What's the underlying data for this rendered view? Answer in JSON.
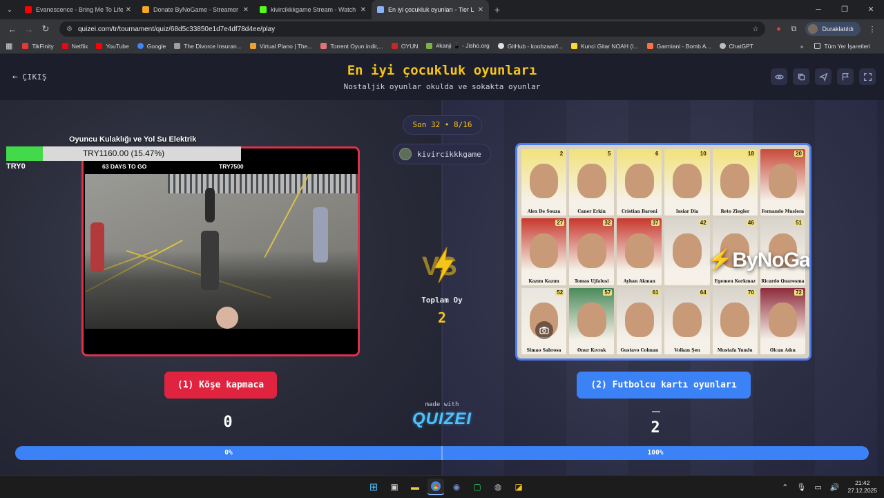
{
  "browser": {
    "tabs": [
      {
        "title": "Evanescence - Bring Me To Life",
        "icon_color": "#ff0000",
        "active": false
      },
      {
        "title": "Donate ByNoGame - Streamer",
        "icon_color": "#f5a623",
        "active": false
      },
      {
        "title": "kivircikkkgame Stream - Watch",
        "icon_color": "#53fc18",
        "active": false
      },
      {
        "title": "En iyi çocukluk oyunları - Tier L",
        "icon_color": "#8ab4f8",
        "active": true
      }
    ],
    "url": "quizei.com/tr/tournament/quiz/68d5c33850e1d7e4df78d4ee/play",
    "profile_label": "Duraklatıldı",
    "bookmarks": [
      {
        "label": "TikFinity",
        "color": "#e53935"
      },
      {
        "label": "Netflix",
        "color": "#e50914"
      },
      {
        "label": "YouTube",
        "color": "#ff0000"
      },
      {
        "label": "Google",
        "color": "#4285f4"
      },
      {
        "label": "The Divorce Insuran...",
        "color": "#9e9e9e"
      },
      {
        "label": "Virtual Piano | The...",
        "color": "#f0a030"
      },
      {
        "label": "Torrent Oyun indir,...",
        "color": "#e57373"
      },
      {
        "label": "OYUN",
        "color": "#c62828"
      },
      {
        "label": "#kanji 📱 - Jisho.org",
        "color": "#7cb342"
      },
      {
        "label": "GitHub - koobzaar/l...",
        "color": "#e0e0e0"
      },
      {
        "label": "Kunci Gitar NOAH (I...",
        "color": "#212121"
      },
      {
        "label": "Garmiani - Bomb A...",
        "color": "#ff7043"
      },
      {
        "label": "ChatGPT",
        "color": "#bdbdbd"
      }
    ],
    "bookmarks_folder": "Tüm Yer İşaretleri"
  },
  "header": {
    "exit_label": "ÇIKIŞ",
    "title": "En iyi çocukluk oyunları",
    "subtitle": "Nostaljik oyunlar okulda ve sokakta oyunlar"
  },
  "round": {
    "label": "Son 32 • 8/16",
    "streamer": "kivircikkkgame"
  },
  "donation_overlay": {
    "title": "Oyuncu Kulaklığı ve Yol Su Elektrik",
    "progress_text": "TRY1160.00 (15.47%)",
    "progress_fraction": 0.1547,
    "min": "TRY0",
    "goal_text": "63 DAYS TO GO",
    "max": "TRY7500"
  },
  "cards": {
    "left_watermark": "",
    "right_watermark": "ByNoGame",
    "player_cards": [
      {
        "name": "Alex De Souza",
        "num": "2"
      },
      {
        "name": "Caner Erkin",
        "num": "5"
      },
      {
        "name": "Cristian Baroni",
        "num": "6"
      },
      {
        "name": "Issiar Dia",
        "num": "10"
      },
      {
        "name": "Reto Ziegler",
        "num": "18"
      },
      {
        "name": "Fernando Muslera",
        "num": "20"
      },
      {
        "name": "Kazım Kazım",
        "num": "27"
      },
      {
        "name": "Tomas Ujfalusi",
        "num": "32"
      },
      {
        "name": "Ayhan Akman",
        "num": "37"
      },
      {
        "name": "",
        "num": "42"
      },
      {
        "name": "Egemen Korkmaz",
        "num": "46"
      },
      {
        "name": "Ricardo Quaresma",
        "num": "51"
      },
      {
        "name": "Simao Sabrosa",
        "num": "52"
      },
      {
        "name": "Onur Kıvrak",
        "num": "57"
      },
      {
        "name": "Gustavo Colman",
        "num": "61"
      },
      {
        "name": "Volkan Şen",
        "num": "64"
      },
      {
        "name": "Mustafa Yumlu",
        "num": "70"
      },
      {
        "name": "Olcan Adın",
        "num": "72"
      }
    ]
  },
  "center": {
    "total_label": "Toplam Oy",
    "total_value": "2",
    "made_with": "made with",
    "brand": "QUIZEI"
  },
  "choices": {
    "left_label": "(1) Köşe kapmaca",
    "right_label": "(2) Futbolcu kartı oyunları",
    "left_score": "0",
    "right_score": "2"
  },
  "progress": {
    "left_pct": "0%",
    "right_pct": "100%",
    "left_fraction": 0.5,
    "right_fraction": 0.5
  },
  "taskbar": {
    "time": "21:42",
    "date": "27.12.2025"
  },
  "colors": {
    "accent_yellow": "#f5c518",
    "left_red": "#e0243f",
    "right_blue": "#3b82f6"
  }
}
